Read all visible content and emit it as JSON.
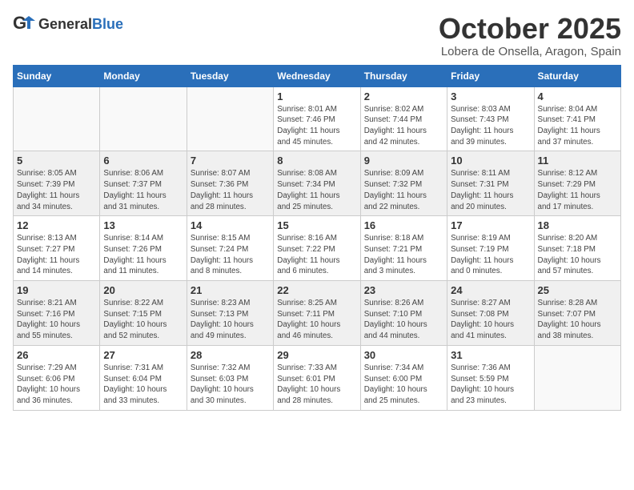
{
  "logo": {
    "general": "General",
    "blue": "Blue"
  },
  "title": "October 2025",
  "location": "Lobera de Onsella, Aragon, Spain",
  "days_of_week": [
    "Sunday",
    "Monday",
    "Tuesday",
    "Wednesday",
    "Thursday",
    "Friday",
    "Saturday"
  ],
  "weeks": [
    [
      {
        "day": "",
        "info": ""
      },
      {
        "day": "",
        "info": ""
      },
      {
        "day": "",
        "info": ""
      },
      {
        "day": "1",
        "info": "Sunrise: 8:01 AM\nSunset: 7:46 PM\nDaylight: 11 hours\nand 45 minutes."
      },
      {
        "day": "2",
        "info": "Sunrise: 8:02 AM\nSunset: 7:44 PM\nDaylight: 11 hours\nand 42 minutes."
      },
      {
        "day": "3",
        "info": "Sunrise: 8:03 AM\nSunset: 7:43 PM\nDaylight: 11 hours\nand 39 minutes."
      },
      {
        "day": "4",
        "info": "Sunrise: 8:04 AM\nSunset: 7:41 PM\nDaylight: 11 hours\nand 37 minutes."
      }
    ],
    [
      {
        "day": "5",
        "info": "Sunrise: 8:05 AM\nSunset: 7:39 PM\nDaylight: 11 hours\nand 34 minutes."
      },
      {
        "day": "6",
        "info": "Sunrise: 8:06 AM\nSunset: 7:37 PM\nDaylight: 11 hours\nand 31 minutes."
      },
      {
        "day": "7",
        "info": "Sunrise: 8:07 AM\nSunset: 7:36 PM\nDaylight: 11 hours\nand 28 minutes."
      },
      {
        "day": "8",
        "info": "Sunrise: 8:08 AM\nSunset: 7:34 PM\nDaylight: 11 hours\nand 25 minutes."
      },
      {
        "day": "9",
        "info": "Sunrise: 8:09 AM\nSunset: 7:32 PM\nDaylight: 11 hours\nand 22 minutes."
      },
      {
        "day": "10",
        "info": "Sunrise: 8:11 AM\nSunset: 7:31 PM\nDaylight: 11 hours\nand 20 minutes."
      },
      {
        "day": "11",
        "info": "Sunrise: 8:12 AM\nSunset: 7:29 PM\nDaylight: 11 hours\nand 17 minutes."
      }
    ],
    [
      {
        "day": "12",
        "info": "Sunrise: 8:13 AM\nSunset: 7:27 PM\nDaylight: 11 hours\nand 14 minutes."
      },
      {
        "day": "13",
        "info": "Sunrise: 8:14 AM\nSunset: 7:26 PM\nDaylight: 11 hours\nand 11 minutes."
      },
      {
        "day": "14",
        "info": "Sunrise: 8:15 AM\nSunset: 7:24 PM\nDaylight: 11 hours\nand 8 minutes."
      },
      {
        "day": "15",
        "info": "Sunrise: 8:16 AM\nSunset: 7:22 PM\nDaylight: 11 hours\nand 6 minutes."
      },
      {
        "day": "16",
        "info": "Sunrise: 8:18 AM\nSunset: 7:21 PM\nDaylight: 11 hours\nand 3 minutes."
      },
      {
        "day": "17",
        "info": "Sunrise: 8:19 AM\nSunset: 7:19 PM\nDaylight: 11 hours\nand 0 minutes."
      },
      {
        "day": "18",
        "info": "Sunrise: 8:20 AM\nSunset: 7:18 PM\nDaylight: 10 hours\nand 57 minutes."
      }
    ],
    [
      {
        "day": "19",
        "info": "Sunrise: 8:21 AM\nSunset: 7:16 PM\nDaylight: 10 hours\nand 55 minutes."
      },
      {
        "day": "20",
        "info": "Sunrise: 8:22 AM\nSunset: 7:15 PM\nDaylight: 10 hours\nand 52 minutes."
      },
      {
        "day": "21",
        "info": "Sunrise: 8:23 AM\nSunset: 7:13 PM\nDaylight: 10 hours\nand 49 minutes."
      },
      {
        "day": "22",
        "info": "Sunrise: 8:25 AM\nSunset: 7:11 PM\nDaylight: 10 hours\nand 46 minutes."
      },
      {
        "day": "23",
        "info": "Sunrise: 8:26 AM\nSunset: 7:10 PM\nDaylight: 10 hours\nand 44 minutes."
      },
      {
        "day": "24",
        "info": "Sunrise: 8:27 AM\nSunset: 7:08 PM\nDaylight: 10 hours\nand 41 minutes."
      },
      {
        "day": "25",
        "info": "Sunrise: 8:28 AM\nSunset: 7:07 PM\nDaylight: 10 hours\nand 38 minutes."
      }
    ],
    [
      {
        "day": "26",
        "info": "Sunrise: 7:29 AM\nSunset: 6:06 PM\nDaylight: 10 hours\nand 36 minutes."
      },
      {
        "day": "27",
        "info": "Sunrise: 7:31 AM\nSunset: 6:04 PM\nDaylight: 10 hours\nand 33 minutes."
      },
      {
        "day": "28",
        "info": "Sunrise: 7:32 AM\nSunset: 6:03 PM\nDaylight: 10 hours\nand 30 minutes."
      },
      {
        "day": "29",
        "info": "Sunrise: 7:33 AM\nSunset: 6:01 PM\nDaylight: 10 hours\nand 28 minutes."
      },
      {
        "day": "30",
        "info": "Sunrise: 7:34 AM\nSunset: 6:00 PM\nDaylight: 10 hours\nand 25 minutes."
      },
      {
        "day": "31",
        "info": "Sunrise: 7:36 AM\nSunset: 5:59 PM\nDaylight: 10 hours\nand 23 minutes."
      },
      {
        "day": "",
        "info": ""
      }
    ]
  ]
}
